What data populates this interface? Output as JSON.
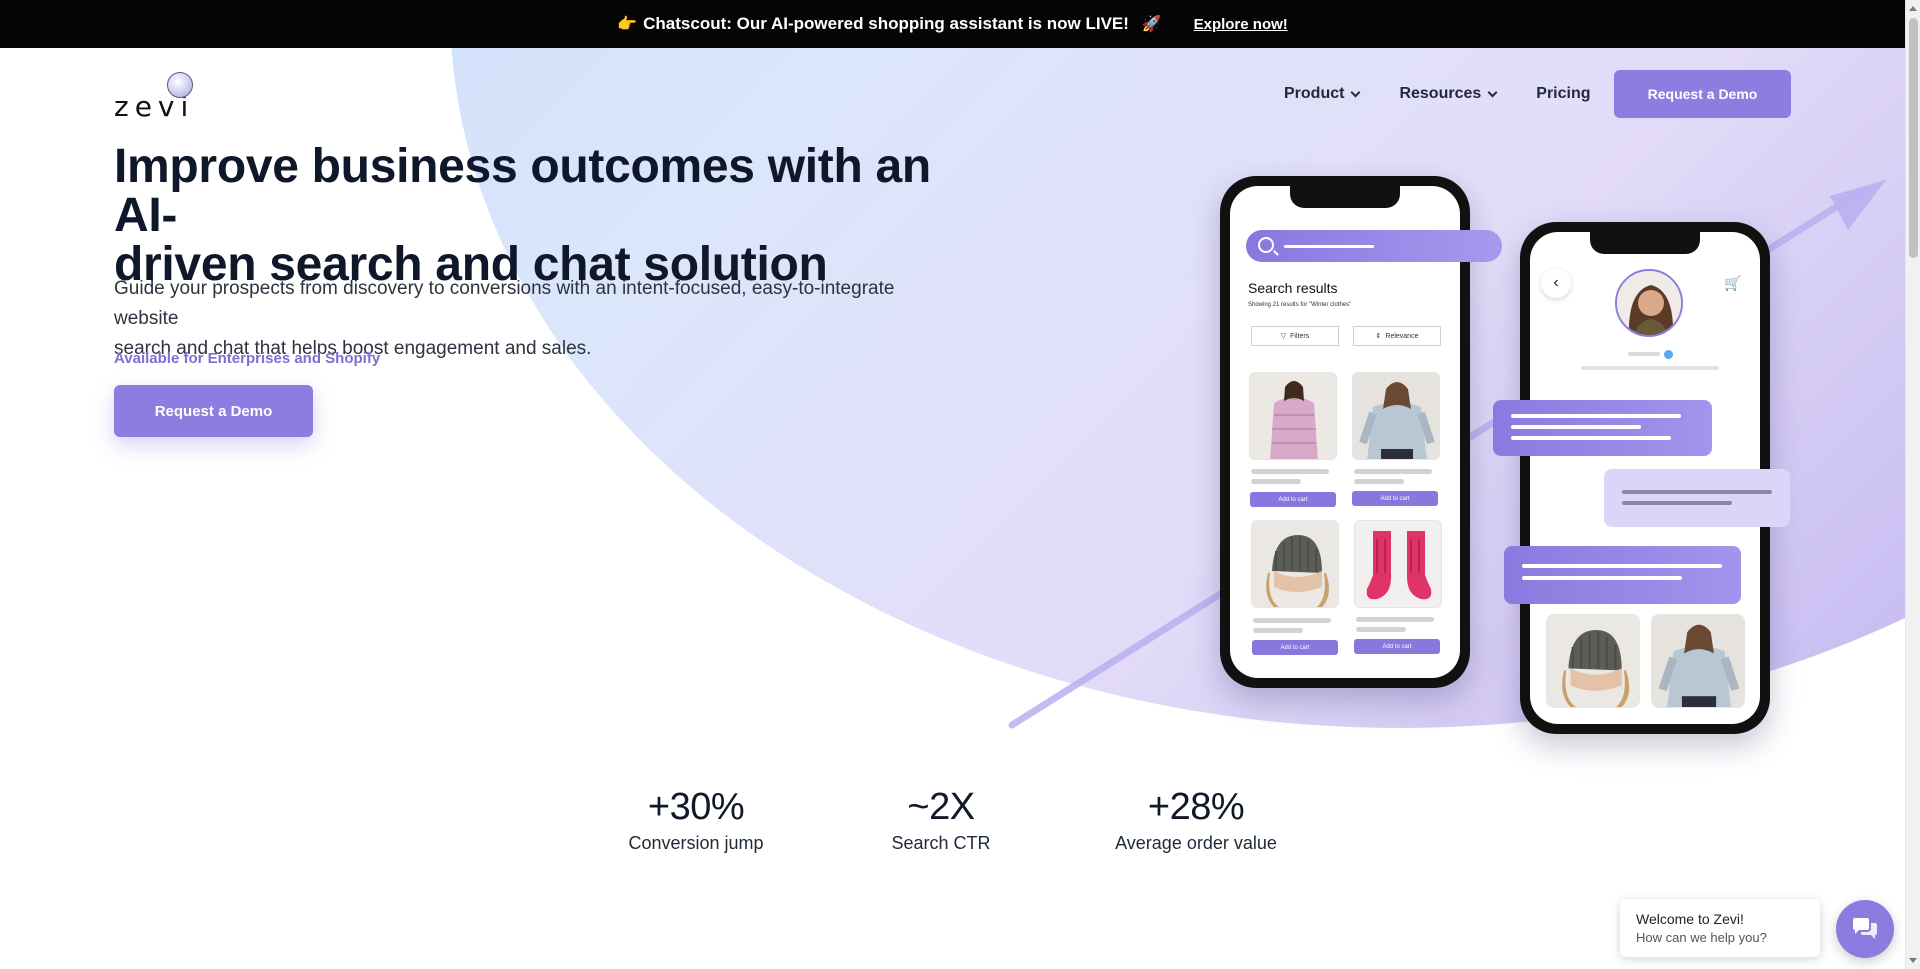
{
  "announcement": {
    "emoji": "👉",
    "text": "Chatscout: Our AI-powered shopping assistant is now LIVE!",
    "rocket": "🚀",
    "link": "Explore now!"
  },
  "brand": {
    "logo_text": "zevi"
  },
  "nav": {
    "items": [
      {
        "label": "Product",
        "has_dropdown": true
      },
      {
        "label": "Resources",
        "has_dropdown": true
      },
      {
        "label": "Pricing",
        "has_dropdown": false
      }
    ],
    "cta": "Request a Demo"
  },
  "hero": {
    "title_line1": "Improve business outcomes with an AI-",
    "title_line2": "driven search and chat solution",
    "desc_line1": "Guide your prospects from discovery to conversions with an intent-focused, easy-to-integrate website",
    "desc_line2": "search and chat that helps boost engagement and sales.",
    "availability": "Available for Enterprises and Shopify",
    "cta": "Request a Demo"
  },
  "mockup": {
    "search_results_title": "Search results",
    "search_results_sub": "Showing 21 results for \"Winter clothes\"",
    "filters_label": "Filters",
    "relevance_label": "Relevance",
    "add_to_cart": "Add to cart"
  },
  "stats": [
    {
      "value": "+30%",
      "label": "Conversion jump"
    },
    {
      "value": "~2X",
      "label": "Search CTR"
    },
    {
      "value": "+28%",
      "label": "Average order value"
    }
  ],
  "chat_widget": {
    "greeting": "Welcome to Zevi!",
    "prompt": "How can we help you?"
  },
  "colors": {
    "accent": "#8c7ee0",
    "accent_text": "#7c6fd4",
    "announcement_bg": "#050505"
  }
}
